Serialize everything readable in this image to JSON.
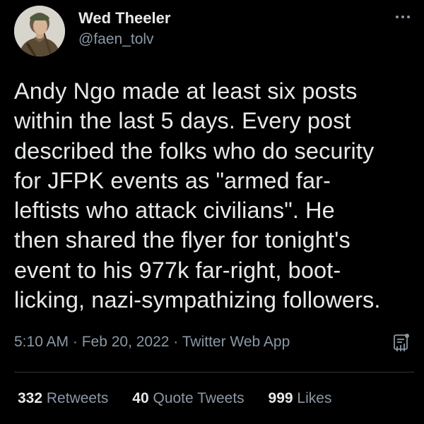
{
  "user": {
    "display_name": "Wed Theeler",
    "handle": "@faen_tolv",
    "avatar_icon": "profile-photo-avatar"
  },
  "tweet": {
    "text_lines": [
      "Andy Ngo made at least six posts",
      "within the last 5 days. Every post",
      "described the folks who do security",
      "for JFPK events as \"armed far-",
      "leftists who attack civilians\". He",
      "then shared the flyer for tonight's",
      "event to his 977k far-right, boot-",
      "licking, nazi-sympathizing followers."
    ],
    "meta": "5:10 AM · Feb 20, 2022 · Twitter Web App"
  },
  "stats": {
    "retweets_count": "332",
    "retweets_label": "Retweets",
    "quotes_count": "40",
    "quotes_label": "Quote Tweets",
    "likes_count": "999",
    "likes_label": "Likes"
  },
  "icons": {
    "more": "more-horizontal-icon",
    "analytics": "analytics-icon"
  },
  "colors": {
    "background": "#000000",
    "primary_text": "#e7e9ea",
    "secondary_text": "#8b98a5",
    "divider": "#2f3336"
  }
}
